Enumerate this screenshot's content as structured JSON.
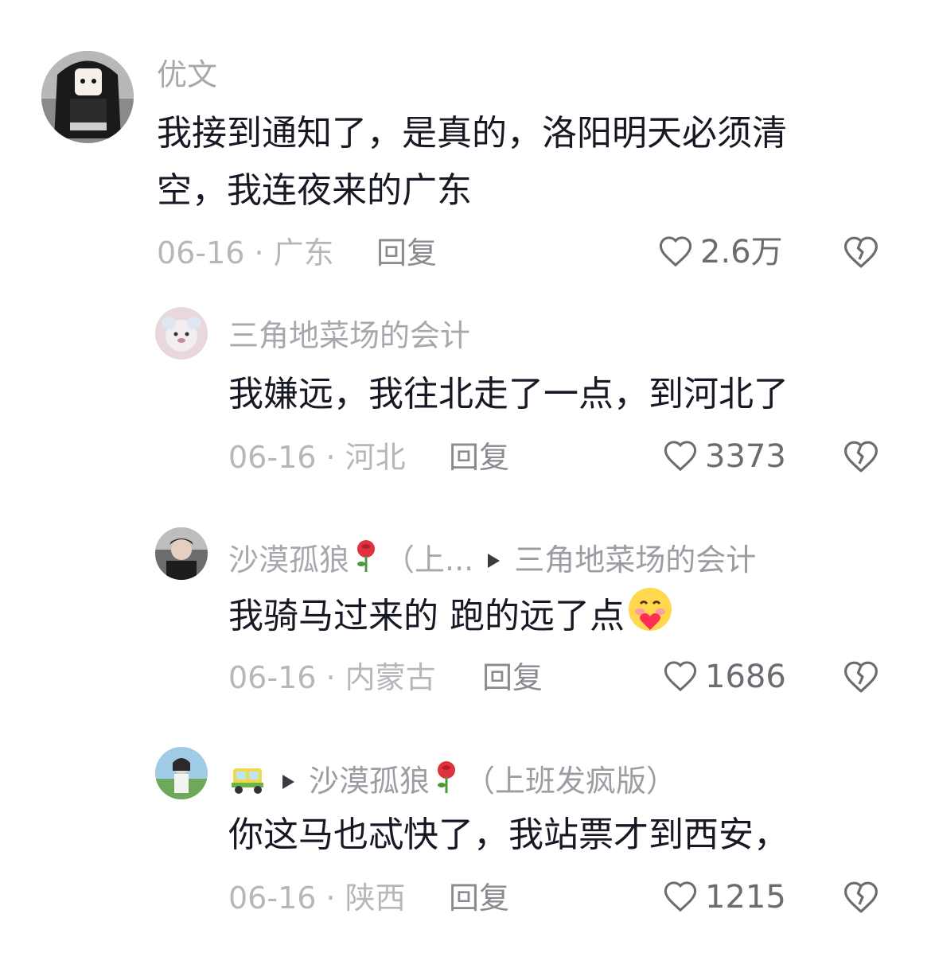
{
  "comments": [
    {
      "username": "优文",
      "text_line1": "我接到通知了，是真的，洛阳明天必须清",
      "text_line2": "空，我连夜来的广东",
      "date_location": "06-16 · 广东",
      "reply_label": "回复",
      "likes": "2.6万"
    },
    {
      "username": "三角地菜场的会计",
      "text": "我嫌远，我往北走了一点，到河北了",
      "date_location": "06-16 · 河北",
      "reply_label": "回复",
      "likes": "3373"
    },
    {
      "username": "沙漠孤狼",
      "username_suffix": "（上...",
      "reply_to": "三角地菜场的会计",
      "text": "我骑马过来的 跑的远了点",
      "date_location": "06-16 · 内蒙古",
      "reply_label": "回复",
      "likes": "1686"
    },
    {
      "reply_to": "沙漠孤狼",
      "reply_to_suffix": "（上班发疯版）",
      "text": "你这马也忒快了，我站票才到西安，",
      "date_location": "06-16 · 陕西",
      "reply_label": "回复",
      "likes": "1215"
    }
  ],
  "icons": {
    "like": "heart-outline-icon",
    "dislike": "broken-heart-icon",
    "reply_arrow": "play-arrow-icon",
    "rose": "rose-emoji",
    "emoji": "blush-heart-emoji",
    "badge": "tuk-tuk-badge"
  },
  "colors": {
    "text": "#161823",
    "username": "#a7a8ad",
    "meta": "#b6b7bb",
    "icon": "#6b6c72"
  }
}
